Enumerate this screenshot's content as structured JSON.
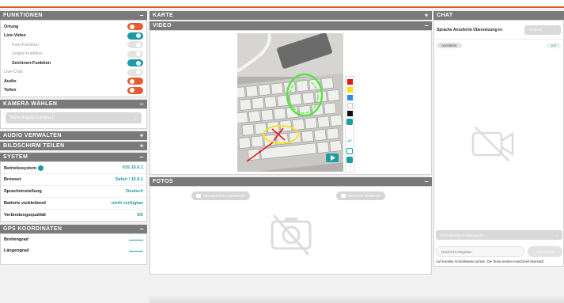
{
  "functions": {
    "title": "FUNKTIONEN",
    "toggle_symbol": "–",
    "items": [
      {
        "label": "Ortung",
        "state": "orange"
      },
      {
        "label": "Live-Video",
        "state": "teal"
      },
      {
        "label": "Foto-Funktion",
        "state": "off"
      },
      {
        "label": "Zeiger-Funktion",
        "state": "off"
      },
      {
        "label": "Zeichnen-Funktion",
        "state": "teal"
      },
      {
        "label": "Live-Chat",
        "state": "off"
      },
      {
        "label": "Audio",
        "state": "orange"
      },
      {
        "label": "Teilen",
        "state": "orange"
      }
    ]
  },
  "camera": {
    "title": "KAMERA WÄHLEN",
    "toggle_symbol": "–",
    "selected": "Keine Angabe (camera 1)"
  },
  "audio": {
    "title": "AUDIO VERWALTEN",
    "toggle_symbol": "+"
  },
  "screen_share": {
    "title": "BILDSCHIRM TEILEN",
    "toggle_symbol": "+"
  },
  "system": {
    "title": "SYSTEM",
    "toggle_symbol": "–",
    "rows": [
      {
        "label": "Betriebssystem",
        "value": "iOS 15.6.1"
      },
      {
        "label": "Browser",
        "value": "Safari / 15.6.1"
      },
      {
        "label": "Spracheinstellung",
        "value": "Deutsch"
      },
      {
        "label": "Batterie verbleibend",
        "value": "nicht verfügbar"
      },
      {
        "label": "Verbindungsqualität",
        "value": "5/5"
      }
    ]
  },
  "gps": {
    "title": "GPS KOORDINATEN",
    "toggle_symbol": "–",
    "rows": [
      {
        "label": "Breitengrad"
      },
      {
        "label": "Längengrad"
      }
    ]
  },
  "map": {
    "title": "KARTE",
    "toggle_symbol": "+"
  },
  "video": {
    "title": "VIDEO",
    "toggle_symbol": "–"
  },
  "photos": {
    "title": "FOTOS",
    "toggle_symbol": "–",
    "standard_label": "Standard-Fotos deaktiviert",
    "hd_label": "HD-Fotos deaktiviert"
  },
  "chat": {
    "title": "CHAT",
    "language_label": "Sprache Anrufer/in Übersetzung in:",
    "language_value": "Deutsch",
    "caller_label": "Anrufer/in",
    "self_label": "Ich",
    "input_placeholder": "Nachricht eingeben",
    "send_label": "Abschicken",
    "note": "Auf korrekte Schreibweise achten. Die Texte werden maschinell übersetzt.",
    "keyboard_label": "Schreibweise Textbausteine"
  },
  "colors": {
    "accent_orange": "#e65c2f",
    "accent_teal": "#1e9aa6",
    "header_gray": "#7a7a7a",
    "palette": [
      "#e8161b",
      "#f4e11a",
      "#2b8ee6",
      "#ffffff",
      "#111111"
    ]
  }
}
